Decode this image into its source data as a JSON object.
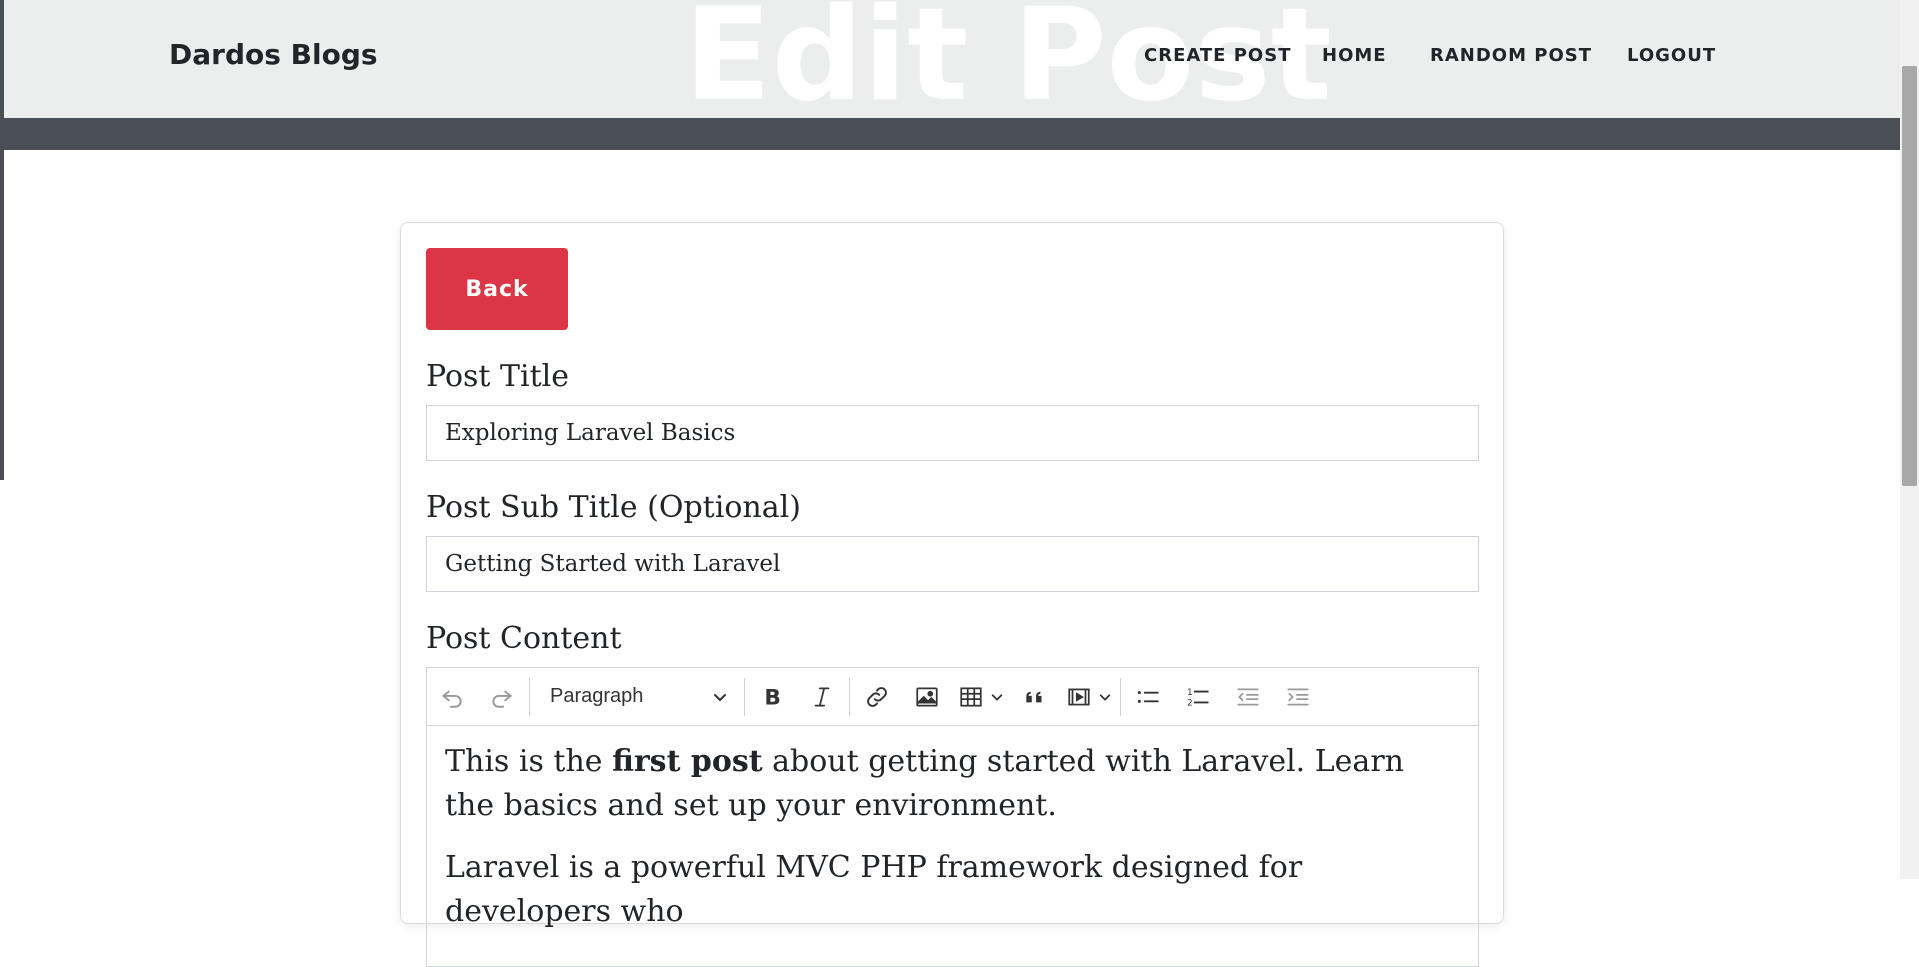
{
  "brand": "Dardos Blogs",
  "hero_title": "Edit Post",
  "nav": {
    "create_post": "CREATE POST",
    "home": "HOME",
    "random_post": "RANDOM POST",
    "logout": "LOGOUT"
  },
  "form": {
    "back_label": "Back",
    "title_label": "Post Title",
    "title_value": "Exploring Laravel Basics",
    "subtitle_label": "Post Sub Title (Optional)",
    "subtitle_value": "Getting Started with Laravel",
    "content_label": "Post Content"
  },
  "editor": {
    "heading_select": "Paragraph",
    "paragraph1": {
      "before": "This is the ",
      "bold": "first post",
      "after": " about getting started with Laravel. Learn the basics and set up your environment."
    },
    "paragraph2_partial": "Laravel is a powerful MVC PHP framework designed for developers who"
  },
  "colors": {
    "header_bg": "#eceded",
    "dark_band": "#4a4f56",
    "back_button": "#dc3545"
  }
}
